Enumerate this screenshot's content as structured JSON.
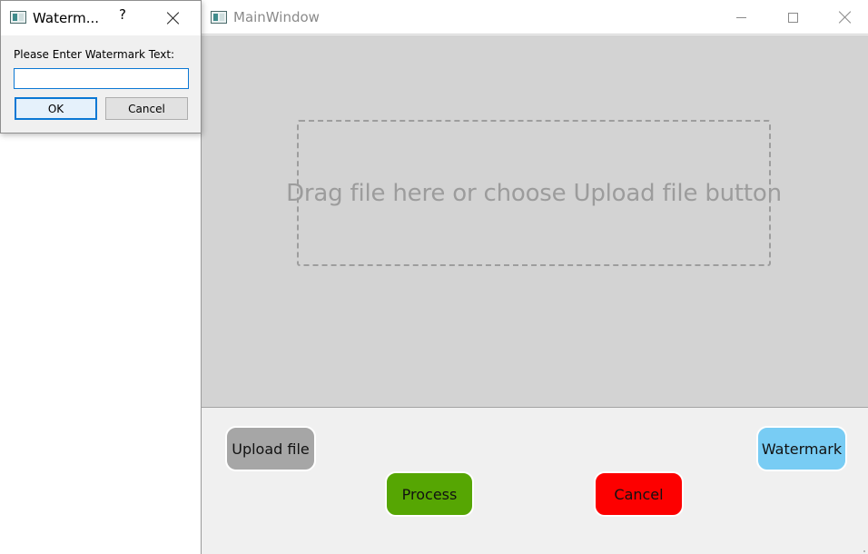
{
  "main_window": {
    "title": "MainWindow",
    "drop_hint": "Drag file here or choose Upload file button",
    "buttons": {
      "upload": "Upload file",
      "process": "Process",
      "cancel": "Cancel",
      "watermark": "Watermark"
    },
    "colors": {
      "upload": "#a6a6a6",
      "process": "#56a603",
      "cancel": "#fd0000",
      "watermark": "#78ccf4",
      "drop_area": "#d3d3d3"
    }
  },
  "dialog": {
    "title": "Waterm...",
    "help": "?",
    "prompt": "Please Enter Watermark Text:",
    "input_value": "",
    "ok_label": "OK",
    "cancel_label": "Cancel"
  },
  "icons": [
    "window-app-icon",
    "minimize-icon",
    "maximize-icon",
    "close-icon",
    "help-icon"
  ]
}
